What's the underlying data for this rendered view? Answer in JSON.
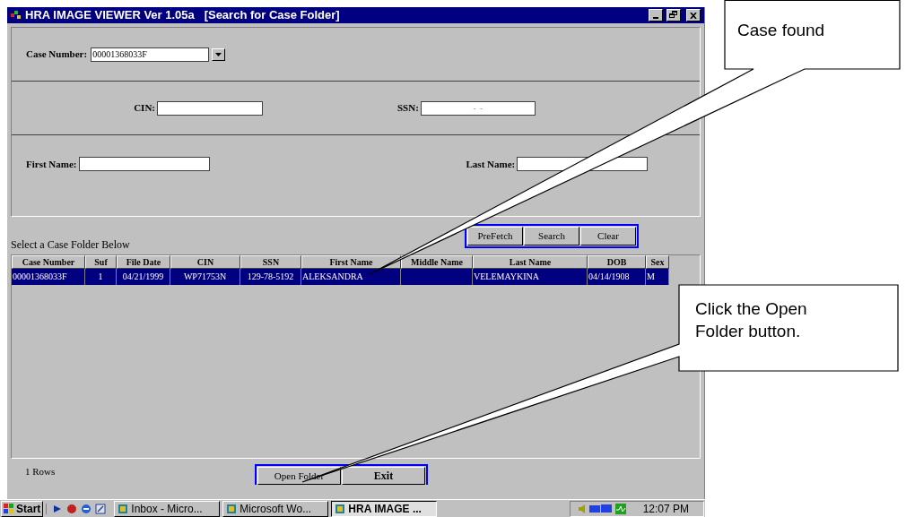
{
  "window": {
    "title": "HRA IMAGE VIEWER Ver 1.05a   [Search for Case Folder]"
  },
  "form": {
    "case_number": {
      "label": "Case Number:",
      "value": "00001368033F"
    },
    "cin": {
      "label": "CIN:"
    },
    "ssn": {
      "label": "SSN:",
      "value": "-  -"
    },
    "first_name": {
      "label": "First Name:"
    },
    "last_name": {
      "label": "Last Name:"
    }
  },
  "search_buttons": [
    "PreFetch",
    "Search",
    "Clear"
  ],
  "list_label": "Select a Case Folder Below",
  "table": {
    "columns": [
      "Case Number",
      "Suf",
      "File Date",
      "CIN",
      "SSN",
      "First Name",
      "Middle Name",
      "Last Name",
      "DOB",
      "Sex"
    ],
    "rows": [
      {
        "selected": true,
        "cells": [
          "00001368033F",
          "1",
          "04/21/1999",
          "WP71753N",
          "129-78-5192",
          "ALEKSANDRA",
          "",
          "VELEMAYKINA",
          "04/14/1908",
          "M"
        ]
      }
    ]
  },
  "row_count": "1 Rows",
  "footer_buttons": [
    "Open Folder",
    "Exit"
  ],
  "taskbar": {
    "start": "Start",
    "tasks": [
      {
        "label": "Inbox - Micro...",
        "selected": false
      },
      {
        "label": "Microsoft Wo...",
        "selected": false
      },
      {
        "label": "HRA IMAGE ...",
        "selected": true
      }
    ],
    "clock": "12:07 PM"
  },
  "callouts": [
    {
      "text": "Case found"
    },
    {
      "text": "Click the Open Folder button."
    }
  ]
}
